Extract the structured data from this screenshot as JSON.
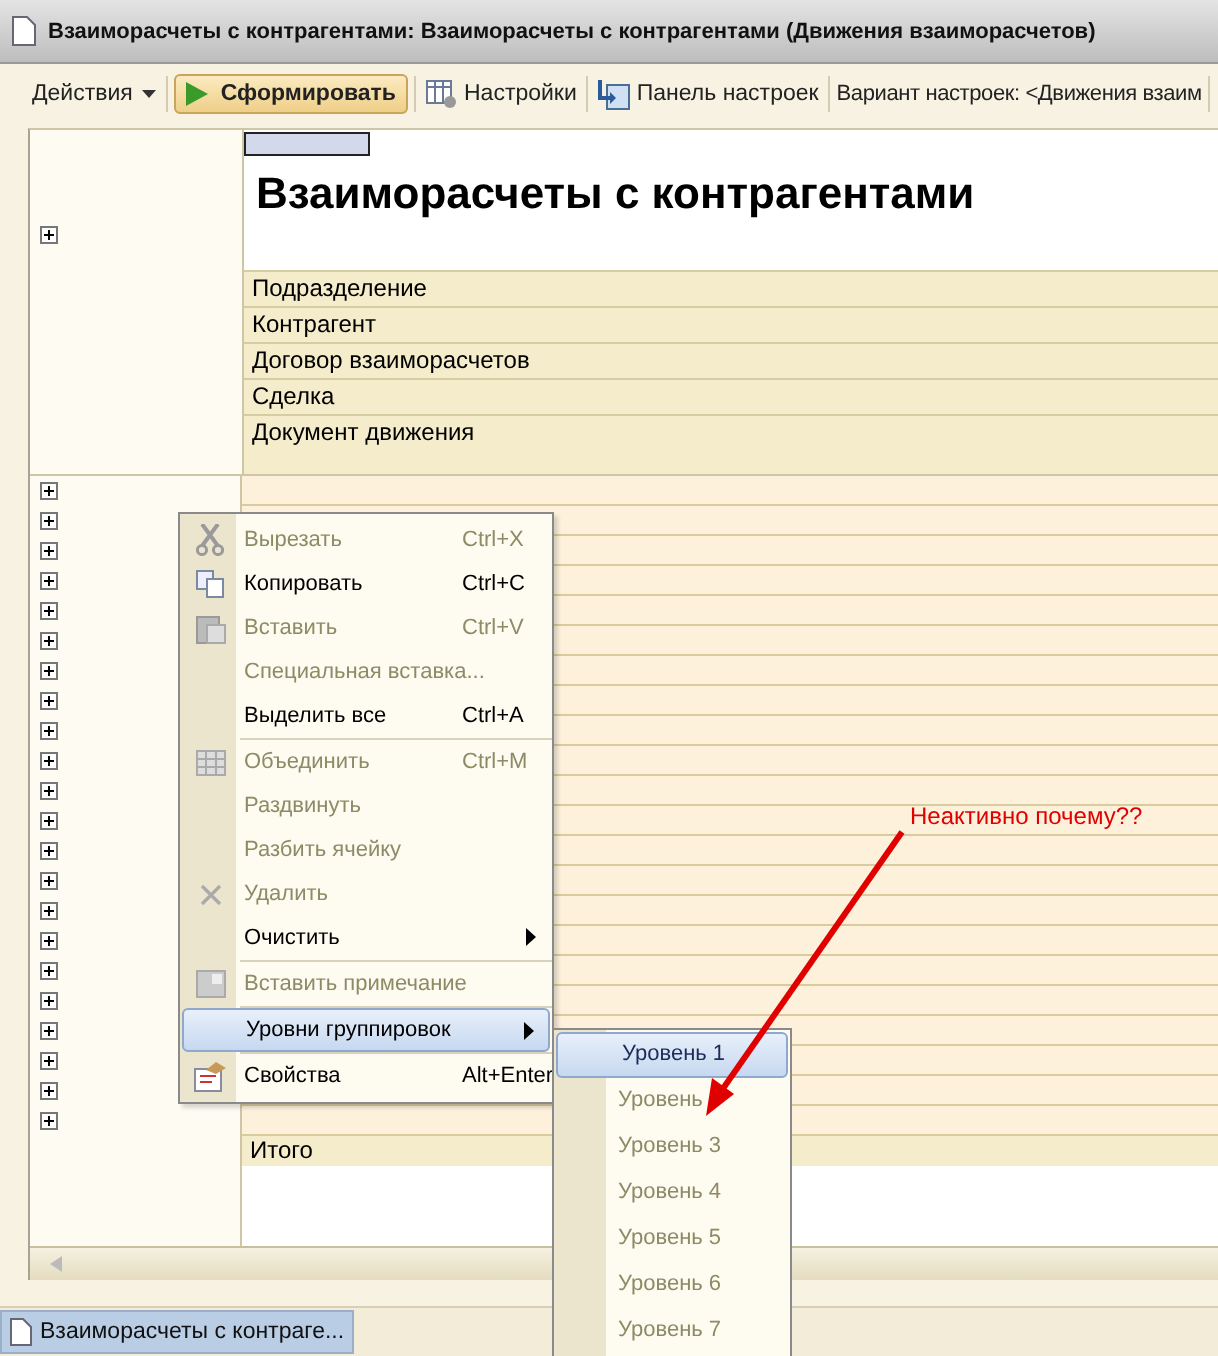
{
  "window": {
    "title": "Взаиморасчеты с контрагентами: Взаиморасчеты с контрагентами (Движения взаиморасчетов)"
  },
  "toolbar": [
    {
      "kind": "menu",
      "label": "Действия"
    },
    {
      "kind": "primary",
      "label": "Сформировать"
    },
    {
      "kind": "icon-button",
      "label": "Настройки"
    },
    {
      "kind": "icon-button",
      "label": "Панель настроек"
    },
    {
      "kind": "text",
      "label": "Вариант настроек: <Движения взаим"
    }
  ],
  "report": {
    "title": "Взаиморасчеты с контрагентами",
    "header_rows": [
      "Подразделение",
      "Контрагент",
      "Договор взаиморасчетов",
      "Сделка",
      "Документ движения"
    ],
    "total_label": "Итого"
  },
  "context_menu": {
    "items": [
      {
        "kind": "item",
        "label": "Вырезать",
        "shortcut": "Ctrl+X",
        "disabled": true,
        "submenu": false,
        "selected": false
      },
      {
        "kind": "item",
        "label": "Копировать",
        "shortcut": "Ctrl+C",
        "disabled": false,
        "submenu": false,
        "selected": false
      },
      {
        "kind": "item",
        "label": "Вставить",
        "shortcut": "Ctrl+V",
        "disabled": true,
        "submenu": false,
        "selected": false
      },
      {
        "kind": "item",
        "label": "Специальная вставка...",
        "disabled": true,
        "submenu": false,
        "selected": false
      },
      {
        "kind": "item",
        "label": "Выделить все",
        "shortcut": "Ctrl+A",
        "disabled": false,
        "submenu": false,
        "selected": false
      },
      {
        "kind": "separator"
      },
      {
        "kind": "item",
        "label": "Объединить",
        "shortcut": "Ctrl+M",
        "disabled": true,
        "submenu": false,
        "selected": false
      },
      {
        "kind": "item",
        "label": "Раздвинуть",
        "disabled": true,
        "submenu": false,
        "selected": false
      },
      {
        "kind": "item",
        "label": "Разбить ячейку",
        "disabled": true,
        "submenu": false,
        "selected": false
      },
      {
        "kind": "item",
        "label": "Удалить",
        "disabled": true,
        "submenu": false,
        "selected": false
      },
      {
        "kind": "item",
        "label": "Очистить",
        "disabled": false,
        "submenu": true,
        "selected": false
      },
      {
        "kind": "separator"
      },
      {
        "kind": "item",
        "label": "Вставить примечание",
        "disabled": true,
        "submenu": false,
        "selected": false
      },
      {
        "kind": "separator"
      },
      {
        "kind": "item",
        "label": "Уровни группировок",
        "disabled": false,
        "submenu": true,
        "selected": true
      },
      {
        "kind": "separator"
      },
      {
        "kind": "item",
        "label": "Свойства",
        "shortcut": "Alt+Enter",
        "disabled": false,
        "submenu": false,
        "selected": false
      }
    ]
  },
  "submenu": {
    "items": [
      {
        "label": "Уровень 1",
        "selected": true,
        "disabled": false
      },
      {
        "label": "Уровень",
        "selected": false,
        "disabled": true
      },
      {
        "label": "Уровень 3",
        "selected": false,
        "disabled": true
      },
      {
        "label": "Уровень 4",
        "selected": false,
        "disabled": true
      },
      {
        "label": "Уровень 5",
        "selected": false,
        "disabled": true
      },
      {
        "label": "Уровень 6",
        "selected": false,
        "disabled": true
      },
      {
        "label": "Уровень 7",
        "selected": false,
        "disabled": true
      }
    ]
  },
  "annotation": {
    "text": "Неактивно почему??"
  },
  "taskbar": {
    "items": [
      {
        "label": "Взаиморасчеты с контраге...",
        "selected": true
      }
    ]
  }
}
